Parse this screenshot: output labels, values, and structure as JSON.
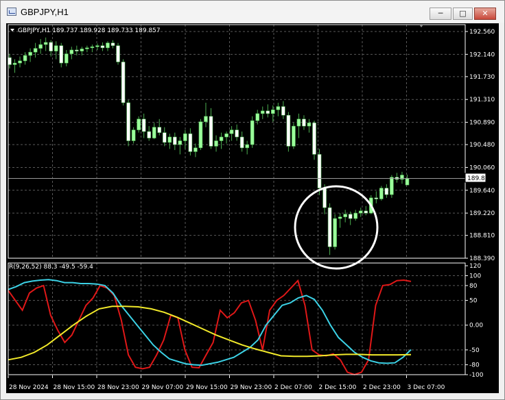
{
  "window": {
    "title": "GBPJPY,H1",
    "minimize_icon": "minimize-icon",
    "maximize_icon": "maximize-icon",
    "close_icon": "close-icon"
  },
  "colors": {
    "background": "#000000",
    "grid": "#5a5a5a",
    "bull_candle": "#9bff9b",
    "bear_candle": "#ffffff",
    "wick": "#4caf50",
    "indicator_red": "#e01818",
    "indicator_cyan": "#3cd2e6",
    "indicator_yellow": "#f2ea2a",
    "highlight_circle": "#ffffff"
  },
  "chart_info": "GBPJPY,H1  189.737 189.928 189.733 189.857",
  "indicator_info": "R(9,26,52) 88.3 -49.5 -59.4",
  "current_price": "189.857",
  "chart_data": [
    {
      "type": "candlestick",
      "symbol": "GBPJPY",
      "timeframe": "H1",
      "ylim": [
        188.39,
        192.56
      ],
      "y_ticks": [
        "192.560",
        "192.140",
        "191.730",
        "191.310",
        "190.890",
        "190.480",
        "190.060",
        "189.640",
        "189.220",
        "188.810",
        "188.390"
      ],
      "x_ticks": [
        "28 Nov 2024",
        "28 Nov 15:00",
        "28 Nov 23:00",
        "29 Nov 07:00",
        "29 Nov 15:00",
        "29 Nov 23:00",
        "2 Dec 07:00",
        "2 Dec 15:00",
        "2 Dec 23:00",
        "3 Dec 07:00"
      ],
      "last": 189.857,
      "candles": [
        [
          192.08,
          192.15,
          191.88,
          191.95
        ],
        [
          191.95,
          192.05,
          191.8,
          191.98
        ],
        [
          191.98,
          192.1,
          191.9,
          192.02
        ],
        [
          192.02,
          192.18,
          191.95,
          192.12
        ],
        [
          192.12,
          192.25,
          192.0,
          192.18
        ],
        [
          192.18,
          192.35,
          192.08,
          192.25
        ],
        [
          192.25,
          192.42,
          192.15,
          192.32
        ],
        [
          192.32,
          192.45,
          192.2,
          192.36
        ],
        [
          192.36,
          192.4,
          192.1,
          192.2
        ],
        [
          192.2,
          192.38,
          192.05,
          192.3
        ],
        [
          192.3,
          192.35,
          191.9,
          191.98
        ],
        [
          191.98,
          192.22,
          191.92,
          192.15
        ],
        [
          192.15,
          192.28,
          192.05,
          192.22
        ],
        [
          192.22,
          192.3,
          192.12,
          192.2
        ],
        [
          192.2,
          192.28,
          192.12,
          192.24
        ],
        [
          192.24,
          192.3,
          192.18,
          192.26
        ],
        [
          192.26,
          192.32,
          192.18,
          192.28
        ],
        [
          192.28,
          192.34,
          192.22,
          192.3
        ],
        [
          192.3,
          192.36,
          192.2,
          192.26
        ],
        [
          192.26,
          192.38,
          192.2,
          192.35
        ],
        [
          192.35,
          192.4,
          192.25,
          192.3
        ],
        [
          192.3,
          192.35,
          191.95,
          192.0
        ],
        [
          192.0,
          192.05,
          191.2,
          191.25
        ],
        [
          191.25,
          191.3,
          190.45,
          190.55
        ],
        [
          190.55,
          190.8,
          190.5,
          190.75
        ],
        [
          190.75,
          191.0,
          190.7,
          190.95
        ],
        [
          190.95,
          191.05,
          190.6,
          190.72
        ],
        [
          190.72,
          190.82,
          190.55,
          190.6
        ],
        [
          190.6,
          190.88,
          190.58,
          190.8
        ],
        [
          190.8,
          190.95,
          190.65,
          190.7
        ],
        [
          190.7,
          190.8,
          190.45,
          190.52
        ],
        [
          190.52,
          190.68,
          190.4,
          190.62
        ],
        [
          190.62,
          190.7,
          190.38,
          190.48
        ],
        [
          190.48,
          190.62,
          190.3,
          190.55
        ],
        [
          190.55,
          190.75,
          190.4,
          190.68
        ],
        [
          190.68,
          190.78,
          190.28,
          190.35
        ],
        [
          190.35,
          190.5,
          190.25,
          190.42
        ],
        [
          190.42,
          190.95,
          190.38,
          190.9
        ],
        [
          190.9,
          191.25,
          190.8,
          191.0
        ],
        [
          191.0,
          191.15,
          190.4,
          190.45
        ],
        [
          190.45,
          190.65,
          190.35,
          190.55
        ],
        [
          190.55,
          190.7,
          190.4,
          190.62
        ],
        [
          190.62,
          190.72,
          190.5,
          190.68
        ],
        [
          190.68,
          190.82,
          190.55,
          190.75
        ],
        [
          190.75,
          190.85,
          190.55,
          190.62
        ],
        [
          190.62,
          190.72,
          190.35,
          190.42
        ],
        [
          190.42,
          190.55,
          190.3,
          190.48
        ],
        [
          190.48,
          191.0,
          190.42,
          190.92
        ],
        [
          190.92,
          191.12,
          190.85,
          191.05
        ],
        [
          191.05,
          191.18,
          190.95,
          191.1
        ],
        [
          191.1,
          191.22,
          190.98,
          191.05
        ],
        [
          191.05,
          191.2,
          190.9,
          191.12
        ],
        [
          191.12,
          191.25,
          191.0,
          191.18
        ],
        [
          191.18,
          191.28,
          190.95,
          191.02
        ],
        [
          191.02,
          191.08,
          190.35,
          190.45
        ],
        [
          190.45,
          190.88,
          190.4,
          190.82
        ],
        [
          190.82,
          191.05,
          190.6,
          190.95
        ],
        [
          190.95,
          191.02,
          190.75,
          190.82
        ],
        [
          190.82,
          190.95,
          190.7,
          190.88
        ],
        [
          190.88,
          190.92,
          190.2,
          190.3
        ],
        [
          190.3,
          190.4,
          189.55,
          189.68
        ],
        [
          189.68,
          189.75,
          189.2,
          189.32
        ],
        [
          189.32,
          189.4,
          188.45,
          188.6
        ],
        [
          188.6,
          189.2,
          188.55,
          189.12
        ],
        [
          189.12,
          189.22,
          188.95,
          189.15
        ],
        [
          189.15,
          189.28,
          189.05,
          189.2
        ],
        [
          189.2,
          189.25,
          189.0,
          189.12
        ],
        [
          189.12,
          189.28,
          189.08,
          189.22
        ],
        [
          189.22,
          189.32,
          189.15,
          189.26
        ],
        [
          189.26,
          189.35,
          189.18,
          189.22
        ],
        [
          189.22,
          189.55,
          189.2,
          189.5
        ],
        [
          189.5,
          189.62,
          189.4,
          189.48
        ],
        [
          189.48,
          189.72,
          189.45,
          189.68
        ],
        [
          189.68,
          189.75,
          189.5,
          189.56
        ],
        [
          189.56,
          189.92,
          189.5,
          189.88
        ],
        [
          189.88,
          189.96,
          189.78,
          189.84
        ],
        [
          189.84,
          189.98,
          189.76,
          189.92
        ],
        [
          189.737,
          189.928,
          189.733,
          189.857
        ]
      ]
    },
    {
      "type": "line",
      "name": "R(9,26,52)",
      "ylim": [
        -100,
        120
      ],
      "y_ticks": [
        "120",
        "100",
        "80",
        "50",
        "0.00",
        "-50",
        "-80",
        "-100"
      ],
      "current_values": [
        88.3,
        -49.5,
        -59.4
      ],
      "series": [
        {
          "color": "#e01818",
          "values": [
            70,
            50,
            30,
            65,
            75,
            80,
            20,
            -10,
            -35,
            -20,
            10,
            40,
            55,
            80,
            75,
            60,
            10,
            -60,
            -85,
            -88,
            -85,
            -60,
            -30,
            20,
            15,
            -50,
            -85,
            -86,
            -60,
            -35,
            30,
            15,
            25,
            45,
            50,
            10,
            -50,
            30,
            50,
            60,
            75,
            90,
            40,
            -50,
            -60,
            -62,
            -58,
            -70,
            -95,
            -100,
            -95,
            -70,
            40,
            80,
            82,
            90,
            91,
            88.3
          ]
        },
        {
          "color": "#3cd2e6",
          "values": [
            72,
            78,
            86,
            89,
            91,
            92,
            90,
            86,
            86,
            84,
            84,
            83,
            80,
            65,
            40,
            20,
            0,
            -20,
            -40,
            -55,
            -68,
            -73,
            -78,
            -80,
            -81,
            -78,
            -75,
            -70,
            -65,
            -55,
            -45,
            -30,
            0,
            20,
            40,
            45,
            55,
            60,
            52,
            30,
            0,
            -25,
            -40,
            -55,
            -65,
            -72,
            -76,
            -77,
            -76,
            -65,
            -49.5
          ]
        },
        {
          "color": "#f2ea2a",
          "values": [
            -70,
            -65,
            -55,
            -40,
            -20,
            0,
            18,
            33,
            38,
            38,
            37,
            33,
            26,
            16,
            4,
            -8,
            -20,
            -30,
            -40,
            -48,
            -55,
            -62,
            -63,
            -63,
            -62,
            -60,
            -59,
            -59,
            -60,
            -60,
            -60,
            -59.4
          ]
        }
      ]
    }
  ]
}
